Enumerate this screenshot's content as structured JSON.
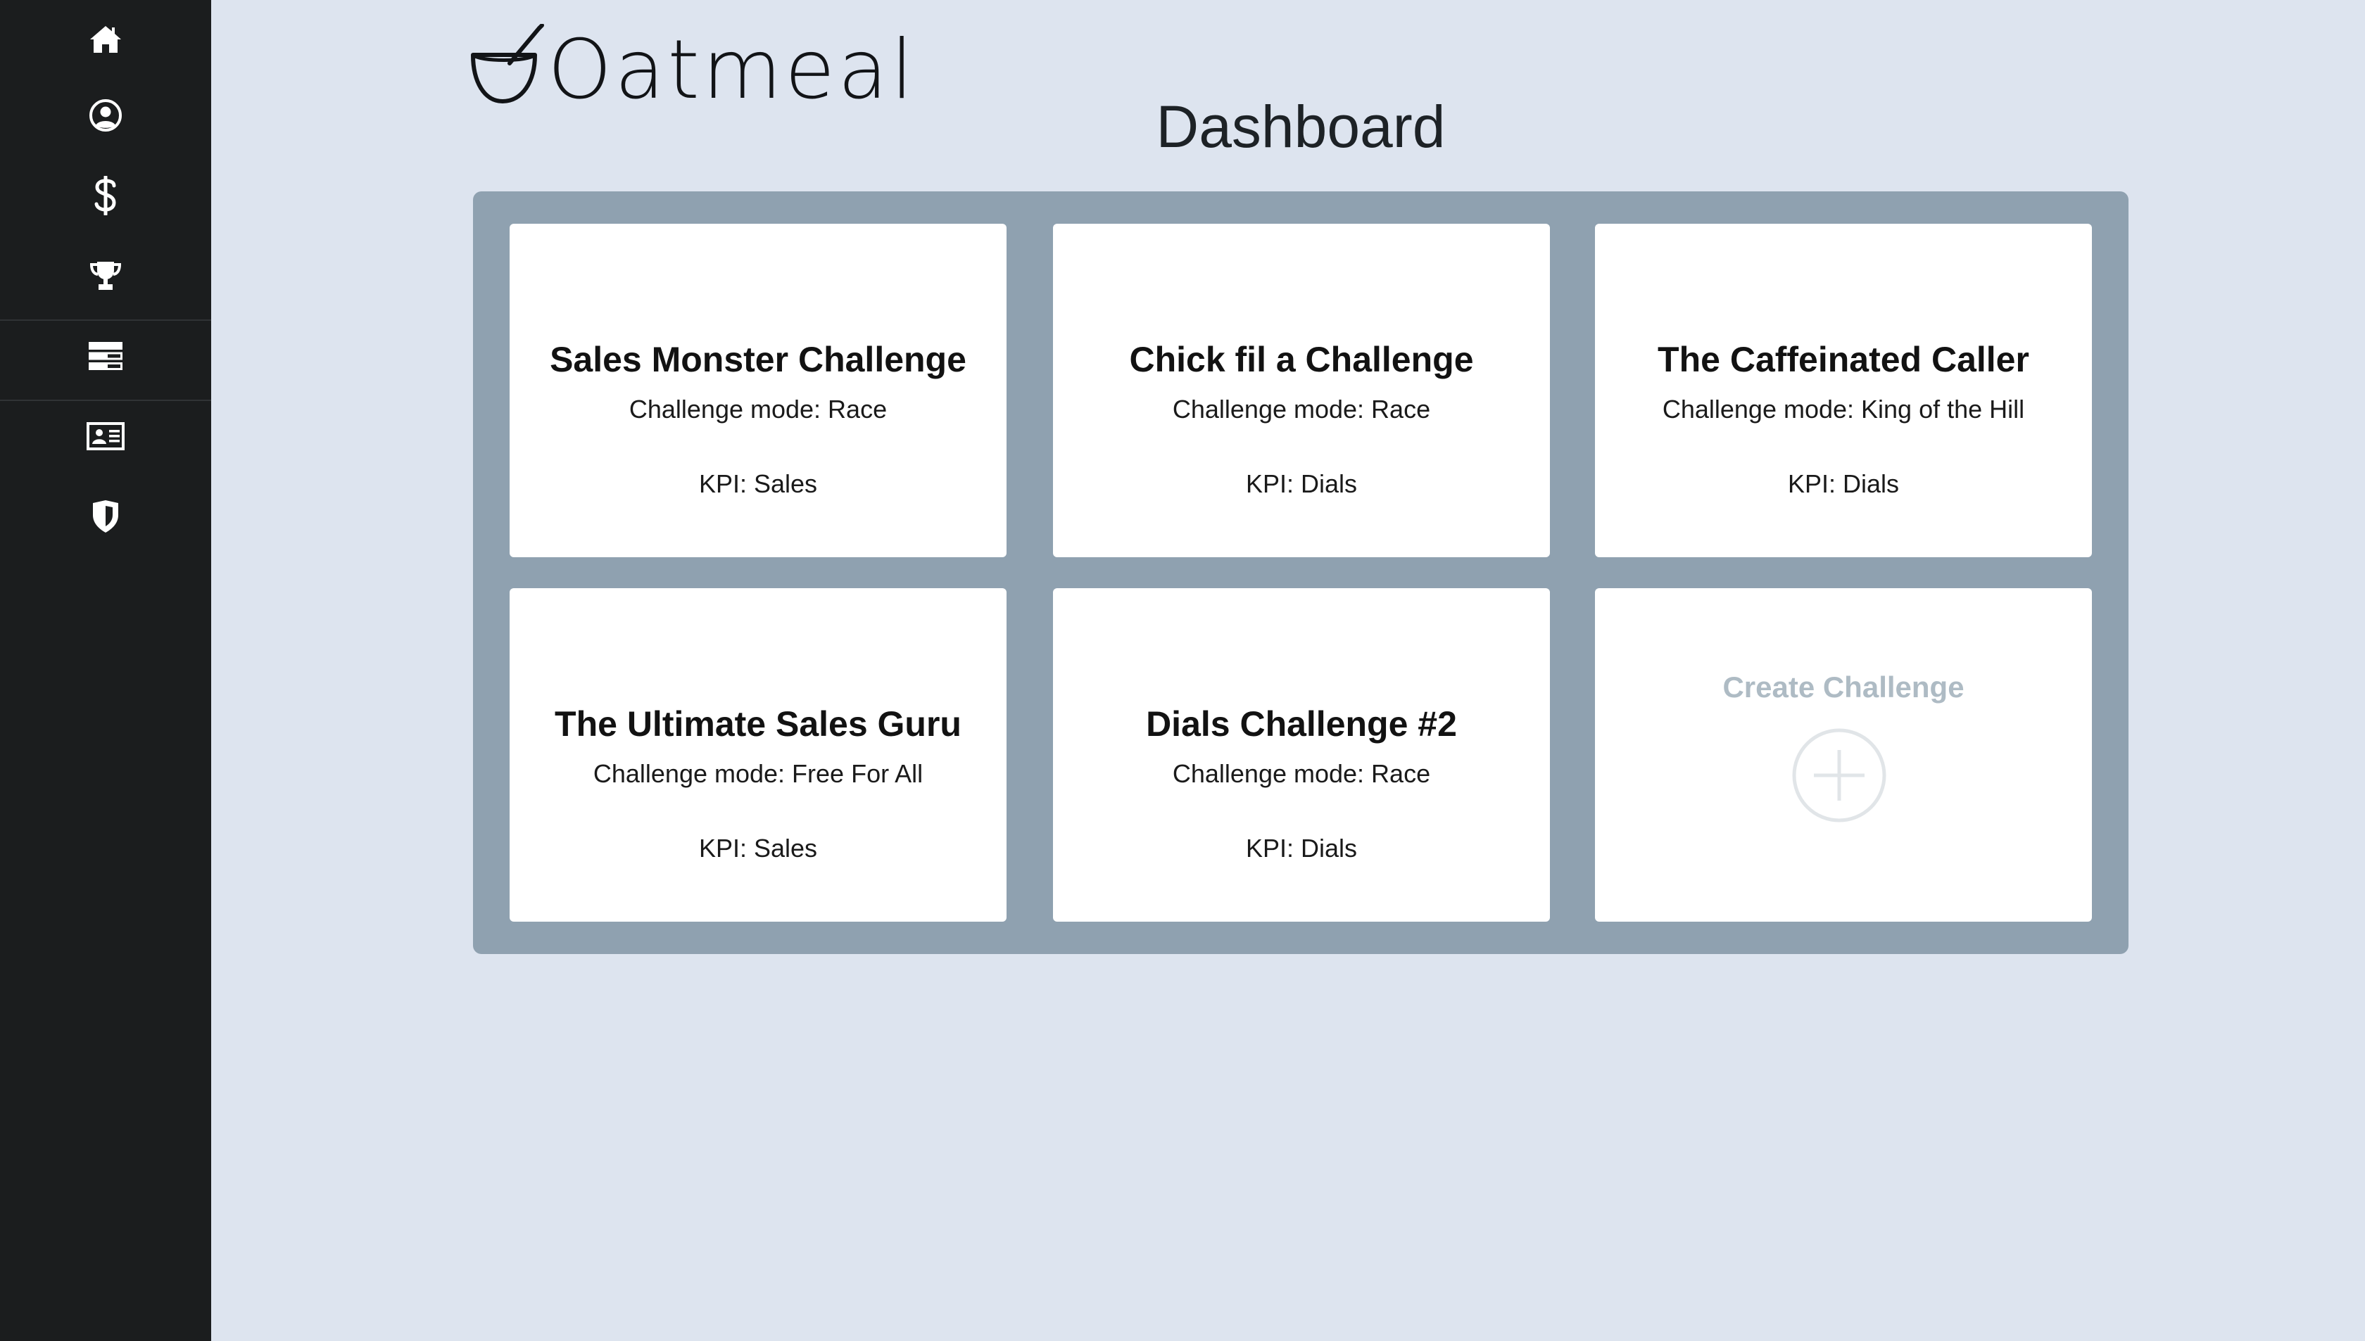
{
  "app": {
    "name": "Oatmeal"
  },
  "sidebar": {
    "items": [
      {
        "icon": "home-icon"
      },
      {
        "icon": "user-circle-icon"
      },
      {
        "icon": "dollar-icon"
      },
      {
        "icon": "trophy-icon"
      },
      {
        "icon": "server-stack-icon"
      },
      {
        "icon": "id-card-icon"
      },
      {
        "icon": "shield-icon"
      }
    ]
  },
  "header": {
    "title": "Dashboard"
  },
  "challenges": [
    {
      "title": "Sales Monster Challenge",
      "mode": "Challenge mode: Race",
      "kpi": "KPI: Sales"
    },
    {
      "title": "Chick fil a Challenge",
      "mode": "Challenge mode: Race",
      "kpi": "KPI: Dials"
    },
    {
      "title": "The Caffeinated Caller",
      "mode": "Challenge mode: King of the Hill",
      "kpi": "KPI: Dials"
    },
    {
      "title": "The Ultimate Sales Guru",
      "mode": "Challenge mode: Free For All",
      "kpi": "KPI: Sales"
    },
    {
      "title": "Dials Challenge #2",
      "mode": "Challenge mode: Race",
      "kpi": "KPI: Dials"
    }
  ],
  "create_card": {
    "label": "Create Challenge",
    "icon": "plus-circle-icon"
  },
  "colors": {
    "sidebar_bg": "#1b1d1e",
    "page_bg": "#dde4ef",
    "board_bg": "#8fa1b0",
    "card_bg": "#ffffff",
    "muted_text": "#aebbc4"
  }
}
